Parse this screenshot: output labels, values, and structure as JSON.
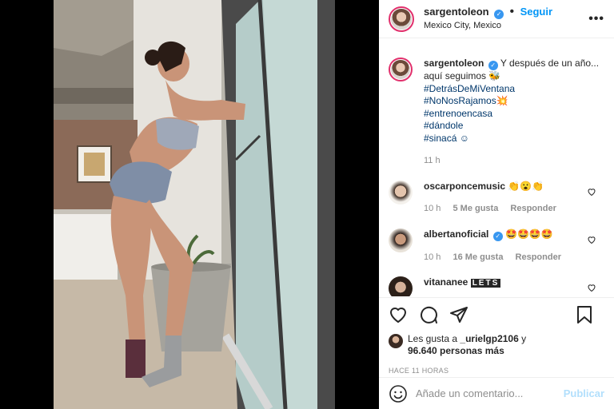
{
  "post": {
    "username": "sargentoleon",
    "follow_label": "Seguir",
    "location": "Mexico City, Mexico",
    "more_label": "•••"
  },
  "caption": {
    "username": "sargentoleon",
    "text": "Y después de un año... aquí seguimos 🐝",
    "hashtags": [
      "#DetrásDeMiVentana",
      "#NoNosRajamos💥",
      "#entrenoencasa",
      "#dándole",
      "#sinacá ☺"
    ],
    "time": "11 h"
  },
  "comments": [
    {
      "username": "oscarponcemusic",
      "text": "👏😮👏",
      "time": "10 h",
      "likes": "5 Me gusta",
      "reply": "Responder"
    },
    {
      "username": "albertanoficial",
      "text": "🤩🤩🤩🤩",
      "time": "10 h",
      "likes": "16 Me gusta",
      "reply": "Responder"
    },
    {
      "username": "vitananee",
      "text": "LETS",
      "time": "",
      "likes": "",
      "reply": ""
    }
  ],
  "likes": {
    "prefix": "Les gusta a ",
    "user": "_urielgp2106",
    "suffix": " y",
    "count": "96.640 personas más"
  },
  "timestamp": "HACE 11 HORAS",
  "add_comment": {
    "placeholder": "Añade un comentario...",
    "publish": "Publicar"
  },
  "icons": [
    "heart-icon",
    "comment-icon",
    "share-icon",
    "bookmark-icon",
    "emoji-icon",
    "verified-icon"
  ],
  "colors": {
    "accent": "#0095f6",
    "verified": "#3897f0",
    "publish_disabled": "#b2dffc",
    "meta_gray": "#8e8e8e",
    "hashtag": "#00376b"
  }
}
